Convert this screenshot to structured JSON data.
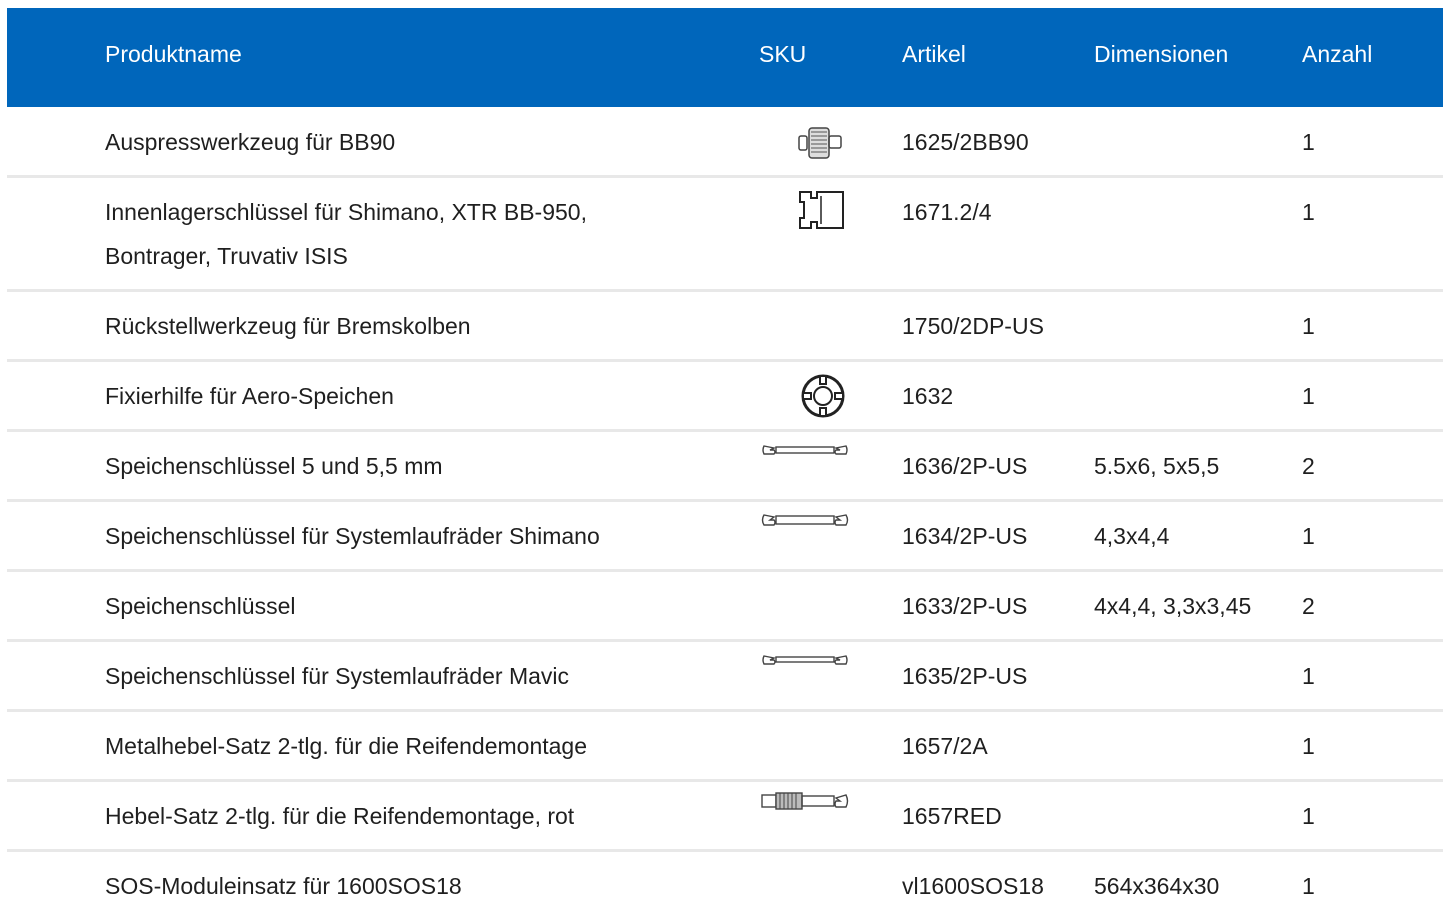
{
  "table": {
    "headers": {
      "name": "Produktname",
      "sku": "SKU",
      "article": "Artikel",
      "dimensions": "Dimensionen",
      "quantity": "Anzahl"
    },
    "rows": [
      {
        "name": "Auspresswerkzeug für BB90",
        "sku_icon": "bearing-press-icon",
        "article": "1625/2BB90",
        "dimensions": "",
        "quantity": "1"
      },
      {
        "name": "Innenlagerschlüssel für Shimano, XTR BB-950,",
        "name2": "Bontrager, Truvativ ISIS",
        "sku_icon": "bottom-bracket-tool-icon",
        "article": "1671.2/4",
        "dimensions": "",
        "quantity": "1"
      },
      {
        "name": "Rückstellwerkzeug für Bremskolben",
        "sku_icon": "",
        "article": "1750/2DP-US",
        "dimensions": "",
        "quantity": "1"
      },
      {
        "name": "Fixierhilfe für Aero-Speichen",
        "sku_icon": "spoke-holder-icon",
        "article": "1632",
        "dimensions": "",
        "quantity": "1"
      },
      {
        "name": "Speichenschlüssel 5 und 5,5 mm",
        "sku_icon": "spoke-wrench-icon",
        "article": "1636/2P-US",
        "dimensions": "5.5x6, 5x5,5",
        "quantity": "2"
      },
      {
        "name": "Speichenschlüssel für Systemlaufräder Shimano",
        "sku_icon": "spoke-wrench-icon",
        "article": "1634/2P-US",
        "dimensions": "4,3x4,4",
        "quantity": "1"
      },
      {
        "name": "Speichenschlüssel",
        "sku_icon": "",
        "article": "1633/2P-US",
        "dimensions": "4x4,4, 3,3x3,45",
        "quantity": "2"
      },
      {
        "name": "Speichenschlüssel für Systemlaufräder Mavic",
        "sku_icon": "spoke-wrench-icon",
        "article": "1635/2P-US",
        "dimensions": "",
        "quantity": "1"
      },
      {
        "name": "Metalhebel-Satz 2-tlg. für die Reifendemontage",
        "sku_icon": "",
        "article": "1657/2A",
        "dimensions": "",
        "quantity": "1"
      },
      {
        "name": "Hebel-Satz 2-tlg. für die Reifendemontage, rot",
        "sku_icon": "tire-lever-icon",
        "article": "1657RED",
        "dimensions": "",
        "quantity": "1"
      },
      {
        "name": "SOS-Moduleinsatz für 1600SOS18",
        "sku_icon": "",
        "article": "vl1600SOS18",
        "dimensions": "564x364x30",
        "quantity": "1"
      }
    ]
  },
  "colors": {
    "header_bg": "#0066bb",
    "header_text": "#ffffff",
    "row_divider": "#e8e8e8"
  }
}
